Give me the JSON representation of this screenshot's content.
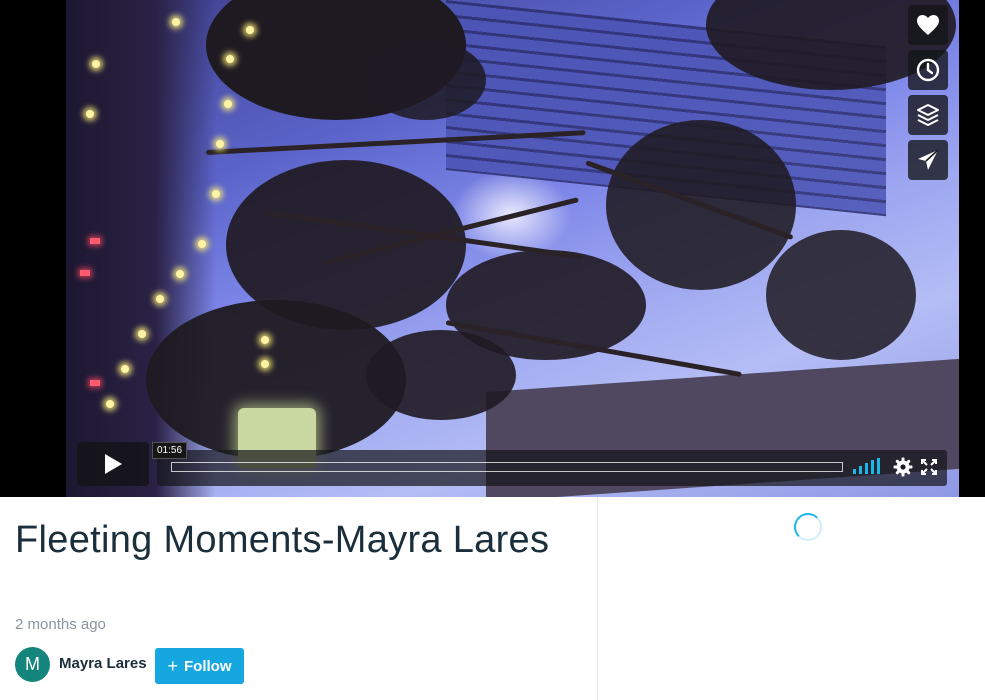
{
  "video": {
    "current_time": "01:56",
    "progress_fraction": 0.0,
    "side_actions": [
      {
        "icon": "heart-icon"
      },
      {
        "icon": "clock-icon"
      },
      {
        "icon": "layers-icon"
      },
      {
        "icon": "send-icon"
      }
    ],
    "controls": {
      "play_icon": "play-icon",
      "volume_icon": "volume-bars-icon",
      "settings_icon": "gear-icon",
      "fullscreen_icon": "fullscreen-icon"
    }
  },
  "details": {
    "title": "Fleeting Moments-Mayra Lares",
    "posted": "2 months ago",
    "author": {
      "initial": "M",
      "name": "Mayra Lares"
    },
    "follow_label": "Follow",
    "follow_icon": "plus-icon"
  },
  "colors": {
    "accent": "#1ab7ea",
    "follow_button": "#17a7e0",
    "avatar_bg": "#14857c",
    "title_text": "#1a2e3b"
  }
}
